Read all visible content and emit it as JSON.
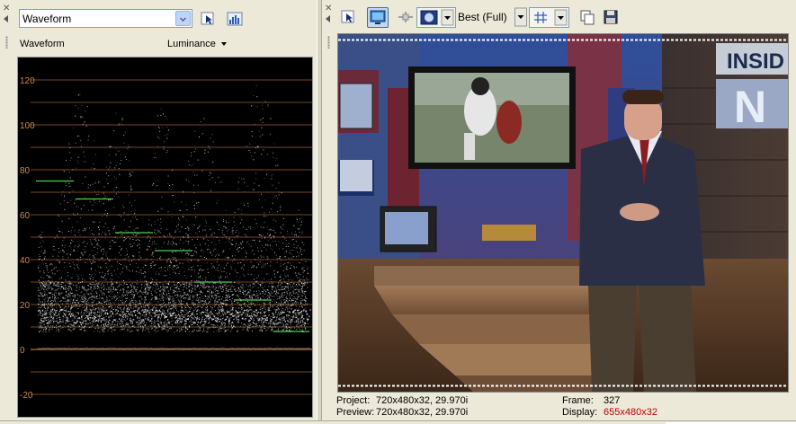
{
  "scopes": {
    "selected_scope": "Waveform",
    "mode_label": "Waveform",
    "channel": "Luminance",
    "y_ticks": [
      "120",
      "100",
      "80",
      "60",
      "40",
      "20",
      "0",
      "-20"
    ],
    "icons": {
      "close": "close-icon",
      "collapse": "arrow-left-icon",
      "pointer": "pointer-icon",
      "settings": "scope-settings-icon"
    }
  },
  "preview": {
    "quality": "Best (Full)",
    "icons": {
      "pointer": "pointer-icon",
      "external_monitor": "monitor-icon",
      "split": "split-screen-icon",
      "overlay": "overlay-icon",
      "grid": "grid-icon",
      "copy": "copy-icon",
      "save": "save-icon"
    },
    "status": {
      "project_label": "Project:",
      "project_value": "720x480x32, 29.970i",
      "preview_label": "Preview:",
      "preview_value": "720x480x32, 29.970i",
      "frame_label": "Frame:",
      "frame_value": "327",
      "display_label": "Display:",
      "display_value": "655x480x32"
    },
    "monitor_text": {
      "sign_1": "INSID",
      "sign_2": "N"
    }
  },
  "colors": {
    "scope_bg": "#000000",
    "graticule": "#b8733a",
    "tick_label": "#d28a4a",
    "display_value": "#c00000"
  }
}
